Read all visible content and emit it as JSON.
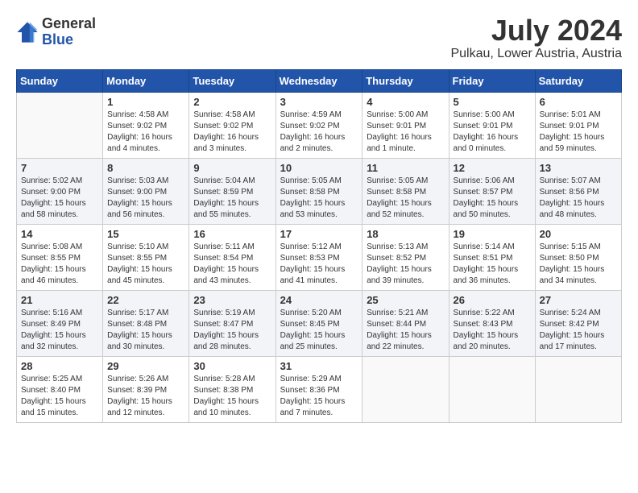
{
  "logo": {
    "general": "General",
    "blue": "Blue"
  },
  "title": "July 2024",
  "location": "Pulkau, Lower Austria, Austria",
  "weekdays": [
    "Sunday",
    "Monday",
    "Tuesday",
    "Wednesday",
    "Thursday",
    "Friday",
    "Saturday"
  ],
  "weeks": [
    [
      {
        "day": "",
        "info": ""
      },
      {
        "day": "1",
        "info": "Sunrise: 4:58 AM\nSunset: 9:02 PM\nDaylight: 16 hours\nand 4 minutes."
      },
      {
        "day": "2",
        "info": "Sunrise: 4:58 AM\nSunset: 9:02 PM\nDaylight: 16 hours\nand 3 minutes."
      },
      {
        "day": "3",
        "info": "Sunrise: 4:59 AM\nSunset: 9:02 PM\nDaylight: 16 hours\nand 2 minutes."
      },
      {
        "day": "4",
        "info": "Sunrise: 5:00 AM\nSunset: 9:01 PM\nDaylight: 16 hours\nand 1 minute."
      },
      {
        "day": "5",
        "info": "Sunrise: 5:00 AM\nSunset: 9:01 PM\nDaylight: 16 hours\nand 0 minutes."
      },
      {
        "day": "6",
        "info": "Sunrise: 5:01 AM\nSunset: 9:01 PM\nDaylight: 15 hours\nand 59 minutes."
      }
    ],
    [
      {
        "day": "7",
        "info": "Sunrise: 5:02 AM\nSunset: 9:00 PM\nDaylight: 15 hours\nand 58 minutes."
      },
      {
        "day": "8",
        "info": "Sunrise: 5:03 AM\nSunset: 9:00 PM\nDaylight: 15 hours\nand 56 minutes."
      },
      {
        "day": "9",
        "info": "Sunrise: 5:04 AM\nSunset: 8:59 PM\nDaylight: 15 hours\nand 55 minutes."
      },
      {
        "day": "10",
        "info": "Sunrise: 5:05 AM\nSunset: 8:58 PM\nDaylight: 15 hours\nand 53 minutes."
      },
      {
        "day": "11",
        "info": "Sunrise: 5:05 AM\nSunset: 8:58 PM\nDaylight: 15 hours\nand 52 minutes."
      },
      {
        "day": "12",
        "info": "Sunrise: 5:06 AM\nSunset: 8:57 PM\nDaylight: 15 hours\nand 50 minutes."
      },
      {
        "day": "13",
        "info": "Sunrise: 5:07 AM\nSunset: 8:56 PM\nDaylight: 15 hours\nand 48 minutes."
      }
    ],
    [
      {
        "day": "14",
        "info": "Sunrise: 5:08 AM\nSunset: 8:55 PM\nDaylight: 15 hours\nand 46 minutes."
      },
      {
        "day": "15",
        "info": "Sunrise: 5:10 AM\nSunset: 8:55 PM\nDaylight: 15 hours\nand 45 minutes."
      },
      {
        "day": "16",
        "info": "Sunrise: 5:11 AM\nSunset: 8:54 PM\nDaylight: 15 hours\nand 43 minutes."
      },
      {
        "day": "17",
        "info": "Sunrise: 5:12 AM\nSunset: 8:53 PM\nDaylight: 15 hours\nand 41 minutes."
      },
      {
        "day": "18",
        "info": "Sunrise: 5:13 AM\nSunset: 8:52 PM\nDaylight: 15 hours\nand 39 minutes."
      },
      {
        "day": "19",
        "info": "Sunrise: 5:14 AM\nSunset: 8:51 PM\nDaylight: 15 hours\nand 36 minutes."
      },
      {
        "day": "20",
        "info": "Sunrise: 5:15 AM\nSunset: 8:50 PM\nDaylight: 15 hours\nand 34 minutes."
      }
    ],
    [
      {
        "day": "21",
        "info": "Sunrise: 5:16 AM\nSunset: 8:49 PM\nDaylight: 15 hours\nand 32 minutes."
      },
      {
        "day": "22",
        "info": "Sunrise: 5:17 AM\nSunset: 8:48 PM\nDaylight: 15 hours\nand 30 minutes."
      },
      {
        "day": "23",
        "info": "Sunrise: 5:19 AM\nSunset: 8:47 PM\nDaylight: 15 hours\nand 28 minutes."
      },
      {
        "day": "24",
        "info": "Sunrise: 5:20 AM\nSunset: 8:45 PM\nDaylight: 15 hours\nand 25 minutes."
      },
      {
        "day": "25",
        "info": "Sunrise: 5:21 AM\nSunset: 8:44 PM\nDaylight: 15 hours\nand 22 minutes."
      },
      {
        "day": "26",
        "info": "Sunrise: 5:22 AM\nSunset: 8:43 PM\nDaylight: 15 hours\nand 20 minutes."
      },
      {
        "day": "27",
        "info": "Sunrise: 5:24 AM\nSunset: 8:42 PM\nDaylight: 15 hours\nand 17 minutes."
      }
    ],
    [
      {
        "day": "28",
        "info": "Sunrise: 5:25 AM\nSunset: 8:40 PM\nDaylight: 15 hours\nand 15 minutes."
      },
      {
        "day": "29",
        "info": "Sunrise: 5:26 AM\nSunset: 8:39 PM\nDaylight: 15 hours\nand 12 minutes."
      },
      {
        "day": "30",
        "info": "Sunrise: 5:28 AM\nSunset: 8:38 PM\nDaylight: 15 hours\nand 10 minutes."
      },
      {
        "day": "31",
        "info": "Sunrise: 5:29 AM\nSunset: 8:36 PM\nDaylight: 15 hours\nand 7 minutes."
      },
      {
        "day": "",
        "info": ""
      },
      {
        "day": "",
        "info": ""
      },
      {
        "day": "",
        "info": ""
      }
    ]
  ]
}
